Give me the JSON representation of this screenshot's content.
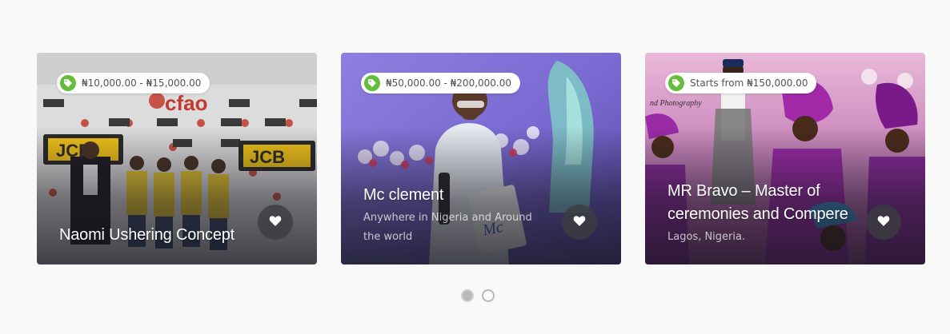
{
  "listings": [
    {
      "price": "₦10,000.00 - ₦15,000.00",
      "title": "Naomi Ushering Concept",
      "subtitle": "",
      "photo_description": "group of ushers in yellow shirts in front of cfao / JCB backdrop"
    },
    {
      "price": "₦50,000.00 - ₦200,000.00",
      "title": "Mc clement",
      "subtitle": "Anywhere in Nigeria and Around the world",
      "photo_description": "MC in white attire holding microphone on purple-lit stage"
    },
    {
      "price": "Starts from ₦150,000.00",
      "title": "MR Bravo – Master of ceremonies and Compere",
      "subtitle": "Lagos, Nigeria.",
      "photo_description": "MC with guests in purple gele at traditional wedding"
    }
  ],
  "icons": {
    "tag": "price-tag-icon",
    "like": "heart-icon"
  },
  "colors": {
    "tag_green": "#64bc3b",
    "page_background": "#f9f9f9"
  },
  "pagination": {
    "pages": 2,
    "active_page": 1
  }
}
